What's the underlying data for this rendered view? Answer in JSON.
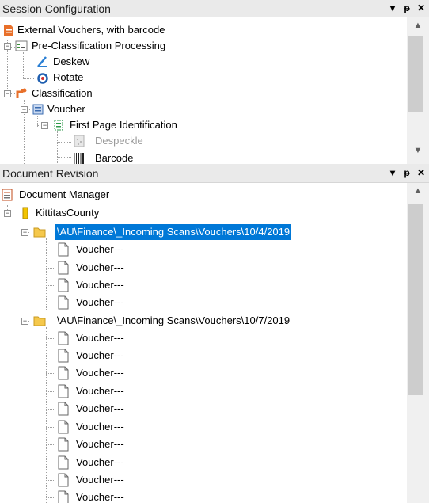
{
  "session": {
    "title": "Session Configuration",
    "items": {
      "root": "External Vouchers, with barcode",
      "preclass": "Pre-Classification Processing",
      "deskew": "Deskew",
      "rotate": "Rotate",
      "classification": "Classification",
      "voucher": "Voucher",
      "first_page": "First Page Identification",
      "despeckle": "Despeckle",
      "barcode": "Barcode"
    }
  },
  "revision": {
    "title": "Document Revision",
    "manager": "Document Manager",
    "county": "KittitasCounty",
    "folder1": "\\AU\\Finance\\_Incoming Scans\\Vouchers\\10/4/2019",
    "folder2": "\\AU\\Finance\\_Incoming Scans\\Vouchers\\10/7/2019",
    "doc_label": "Voucher---"
  },
  "header_buttons": {
    "dropdown": "▾",
    "pin": "ᵽ",
    "close": "✕"
  },
  "colors": {
    "selection": "#0078d7",
    "header_bg": "#eaeaea",
    "folder": "#f5c84c"
  }
}
